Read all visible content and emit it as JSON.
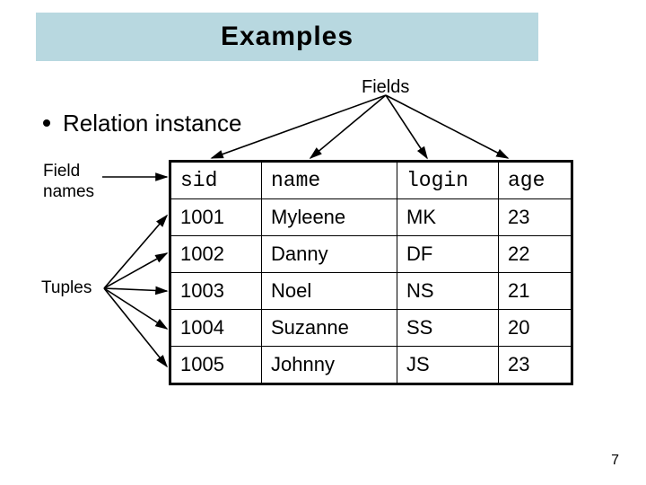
{
  "title": "Examples",
  "fields_label": "Fields",
  "bullet_text": "Relation instance",
  "field_names_label_l1": "Field",
  "field_names_label_l2": "names",
  "tuples_label": "Tuples",
  "page_number": "7",
  "chart_data": {
    "type": "table",
    "title": "Relation instance",
    "columns": [
      "sid",
      "name",
      "login",
      "age"
    ],
    "rows": [
      [
        "1001",
        "Myleene",
        "MK",
        "23"
      ],
      [
        "1002",
        "Danny",
        "DF",
        "22"
      ],
      [
        "1003",
        "Noel",
        "NS",
        "21"
      ],
      [
        "1004",
        "Suzanne",
        "SS",
        "20"
      ],
      [
        "1005",
        "Johnny",
        "JS",
        "23"
      ]
    ]
  }
}
